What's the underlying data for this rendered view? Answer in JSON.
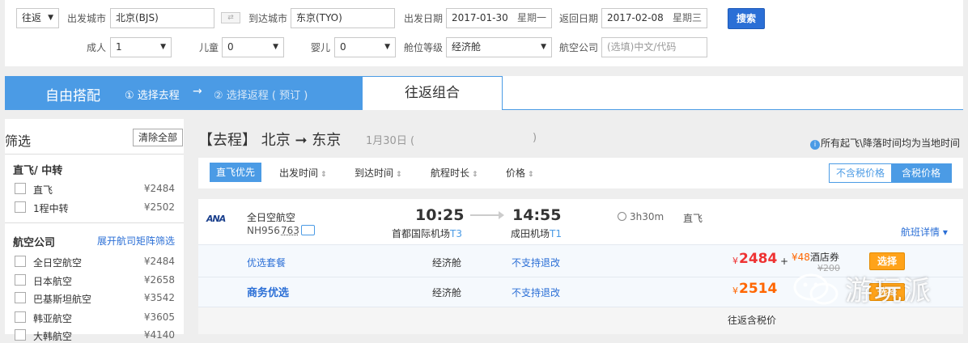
{
  "search": {
    "trip_type": "往返",
    "dep_city_label": "出发城市",
    "dep_city": "北京(BJS)",
    "arr_city_label": "到达城市",
    "arr_city": "东京(TYO)",
    "dep_date_label": "出发日期",
    "dep_date": "2017-01-30",
    "dep_weekday": "星期一",
    "ret_date_label": "返回日期",
    "ret_date": "2017-02-08",
    "ret_weekday": "星期三",
    "search_button": "搜索",
    "adult_label": "成人",
    "adult": "1",
    "child_label": "儿童",
    "child": "0",
    "infant_label": "婴儿",
    "infant": "0",
    "cabin_label": "舱位等级",
    "cabin": "经济舱",
    "airline_label": "航空公司",
    "airline_placeholder": "(选填)中文/代码"
  },
  "tabs": {
    "free": "自由搭配",
    "step1": "① 选择去程",
    "arrow": "→",
    "step2": "② 选择返程 ( 预订 )",
    "combo": "往返组合"
  },
  "sidebar": {
    "title": "筛选",
    "clear": "清除全部",
    "stops_title": "直飞/ 中转",
    "stops": [
      {
        "label": "直飞",
        "price": "¥2484"
      },
      {
        "label": "1程中转",
        "price": "¥2502"
      }
    ],
    "airlines_title": "航空公司",
    "airlines_link": "展开航司矩阵筛选",
    "airlines": [
      {
        "label": "全日空航空",
        "price": "¥2484"
      },
      {
        "label": "日本航空",
        "price": "¥2658"
      },
      {
        "label": "巴基斯坦航空",
        "price": "¥3542"
      },
      {
        "label": "韩亚航空",
        "price": "¥3605"
      },
      {
        "label": "大韩航空",
        "price": "¥4140"
      }
    ]
  },
  "main": {
    "route_title": "【去程】 北京 ➞ 东京",
    "route_date": "1月30日 (",
    "route_date_close": ")",
    "tz_note": "所有起飞\\降落时间均为当地时间",
    "sort": {
      "direct_first": "直飞优先",
      "dep_time": "出发时间",
      "arr_time": "到达时间",
      "duration": "航程时长",
      "price": "价格"
    },
    "price_toggle": {
      "excl": "不含税价格",
      "incl": "含税价格"
    }
  },
  "flight": {
    "logo": "ANA",
    "airline": "全日空航空",
    "flight_no": "NH956",
    "plane": "763",
    "dep_time": "10:25",
    "arr_time": "14:55",
    "dep_airport": "首都国际机场",
    "dep_terminal": "T3",
    "arr_airport": "成田机场",
    "arr_terminal": "T1",
    "duration": "3h30m",
    "direct": "直飞",
    "details": "航班详情 ▾",
    "fares": [
      {
        "package": "优选套餐",
        "cabin": "经济舱",
        "refund": "不支持退改",
        "currency": "¥",
        "price": "2484",
        "plus": "+",
        "voucher_cur": "¥",
        "voucher_amt": "48",
        "voucher_text": "酒店券",
        "voucher_sub": "¥200",
        "select": "选择"
      },
      {
        "package": "商务优选",
        "cabin": "经济舱",
        "refund": "不支持退改",
        "currency": "¥",
        "price": "2514",
        "select": "选择"
      }
    ],
    "footnote": "往返含税价"
  },
  "watermark": {
    "text": "游玩派"
  }
}
